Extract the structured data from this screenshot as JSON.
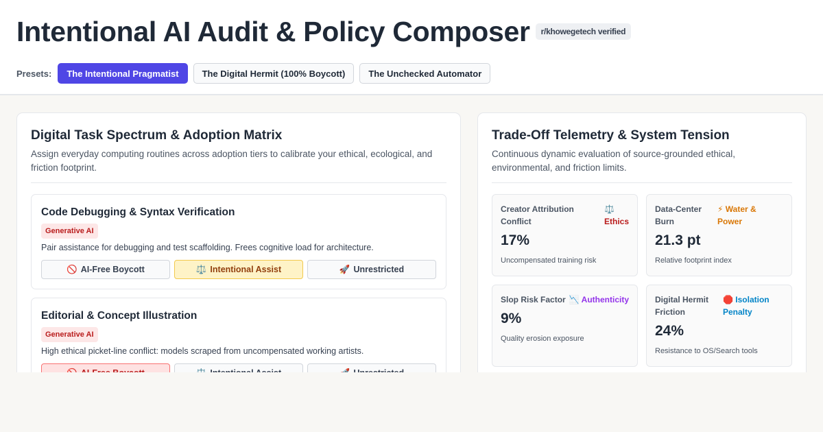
{
  "header": {
    "title": "Intentional AI Audit & Policy Composer",
    "badge": "r/khowegetech verified",
    "presets_label": "Presets:",
    "presets": [
      {
        "label": "The Intentional Pragmatist",
        "active": true
      },
      {
        "label": "The Digital Hermit (100% Boycott)",
        "active": false
      },
      {
        "label": "The Unchecked Automator",
        "active": false
      }
    ]
  },
  "left_panel": {
    "title": "Digital Task Spectrum & Adoption Matrix",
    "subtitle": "Assign everyday computing routines across adoption tiers to calibrate your ethical, ecological, and friction footprint.",
    "tier_labels": {
      "boycott": "AI-Free Boycott",
      "assist": "Intentional Assist",
      "unrestricted": "Unrestricted"
    },
    "tier_icons": {
      "boycott": "🚫",
      "assist": "⚖️",
      "unrestricted": "🚀"
    },
    "tasks": [
      {
        "title": "Code Debugging & Syntax Verification",
        "tag": "Generative AI",
        "description": "Pair assistance for debugging and test scaffolding. Frees cognitive load for architecture.",
        "selected": "assist"
      },
      {
        "title": "Editorial & Concept Illustration",
        "tag": "Generative AI",
        "description": "High ethical picket-line conflict: models scraped from uncompensated working artists.",
        "selected": "boycott"
      }
    ]
  },
  "right_panel": {
    "title": "Trade-Off Telemetry & System Tension",
    "subtitle": "Continuous dynamic evaluation of source-grounded ethical, environmental, and friction limits.",
    "metrics": [
      {
        "name": "Creator Attribution Conflict",
        "icon": "⚖️",
        "tag": "Ethics",
        "tag_color": "#b91c1c",
        "value": "17%",
        "caption": "Uncompensated training risk"
      },
      {
        "name": "Data-Center Burn",
        "icon": "⚡",
        "tag": "Water & Power",
        "tag_color": "#d97706",
        "value": "21.3 pt",
        "caption": "Relative footprint index"
      },
      {
        "name": "Slop Risk Factor",
        "icon": "📉",
        "tag": "Authenticity",
        "tag_color": "#9333ea",
        "value": "9%",
        "caption": "Quality erosion exposure"
      },
      {
        "name": "Digital Hermit Friction",
        "icon": "🛑",
        "tag": "Isolation Penalty",
        "tag_color": "#0284c7",
        "value": "24%",
        "caption": "Resistance to OS/Search tools"
      }
    ]
  }
}
